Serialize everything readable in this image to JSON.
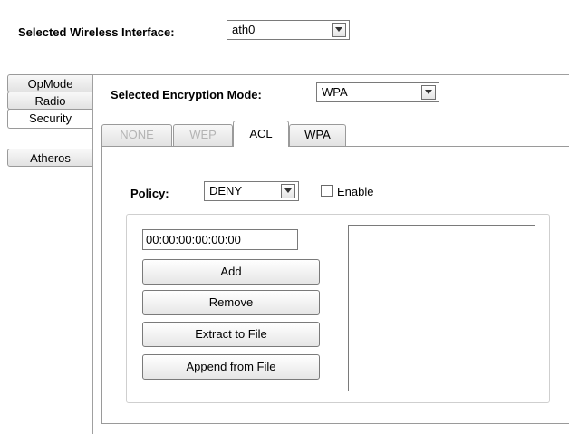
{
  "interface": {
    "label": "Selected Wireless Interface:",
    "value": "ath0"
  },
  "side_tabs": [
    {
      "label": "OpMode",
      "active": false
    },
    {
      "label": "Radio",
      "active": false
    },
    {
      "label": "Security",
      "active": true
    },
    {
      "label": "Atheros",
      "active": false
    }
  ],
  "encryption": {
    "label": "Selected Encryption Mode:",
    "value": "WPA"
  },
  "tabs": [
    {
      "label": "NONE",
      "state": "disabled"
    },
    {
      "label": "WEP",
      "state": "disabled"
    },
    {
      "label": "ACL",
      "state": "active"
    },
    {
      "label": "WPA",
      "state": "normal"
    }
  ],
  "acl": {
    "policy_label": "Policy:",
    "policy_value": "DENY",
    "enable_label": "Enable",
    "enable_checked": false,
    "mac_value": "00:00:00:00:00:00",
    "buttons": {
      "add": "Add",
      "remove": "Remove",
      "extract": "Extract to File",
      "append": "Append from File"
    },
    "mac_list": []
  }
}
